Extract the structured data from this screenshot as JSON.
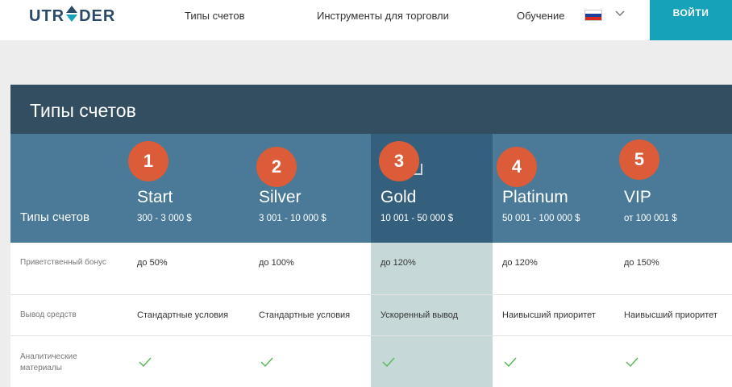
{
  "header": {
    "logo": {
      "left": "UTR",
      "mark_icon": "arrow-diamond-icon",
      "right": "DER"
    },
    "nav": [
      "Типы счетов",
      "Инструменты для торговли",
      "Обучение"
    ],
    "language_flag": "russian-flag-icon",
    "login_label": "ВОЙТИ",
    "accent_color": "#16a2b8"
  },
  "section": {
    "title": "Типы счетов"
  },
  "plans": {
    "row_label": "Типы счетов",
    "items": [
      {
        "badge": "1",
        "name": "Start",
        "range": "300 - 3 000 $"
      },
      {
        "badge": "2",
        "name": "Silver",
        "range": "3 001 - 10 000 $"
      },
      {
        "badge": "3",
        "name": "Gold",
        "range": "10 001 - 50 000 $"
      },
      {
        "badge": "4",
        "name": "Platinum",
        "range": "50 001 - 100 000 $"
      },
      {
        "badge": "5",
        "name": "VIP",
        "range": "от 100 001 $"
      }
    ],
    "badge_color": "#dc5c39"
  },
  "rows": [
    {
      "label": "Приветственный бонус",
      "values": [
        "до 50%",
        "до 100%",
        "до 120%",
        "до 120%",
        "до 150%"
      ]
    },
    {
      "label": "Вывод средств",
      "values": [
        "Стандартные условия",
        "Стандартные условия",
        "Ускоренный вывод",
        "Наивысший приоритет",
        "Наивысший приоритет"
      ]
    },
    {
      "label": "Аналитические материалы",
      "values": [
        "check-icon",
        "check-icon",
        "check-icon",
        "check-icon",
        "check-icon"
      ]
    }
  ]
}
